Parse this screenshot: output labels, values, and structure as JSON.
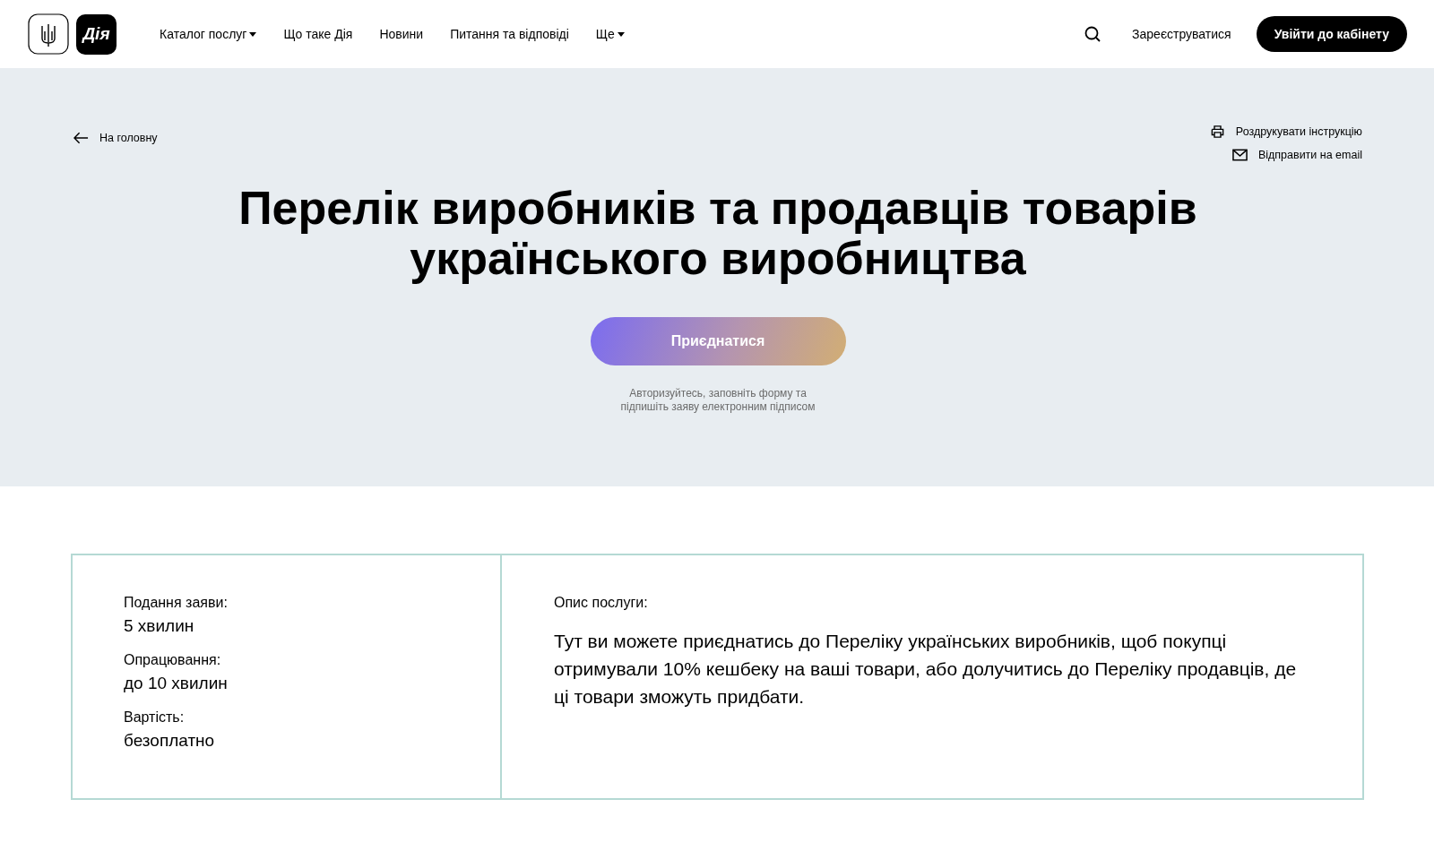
{
  "header": {
    "logo_text": "Дія",
    "nav": [
      {
        "label": "Каталог послуг",
        "dropdown": true
      },
      {
        "label": "Що таке Дія",
        "dropdown": false
      },
      {
        "label": "Новини",
        "dropdown": false
      },
      {
        "label": "Питання та відповіді",
        "dropdown": false
      },
      {
        "label": "Ще",
        "dropdown": true
      }
    ],
    "register": "Зареєструватися",
    "login": "Увійти до кабінету"
  },
  "hero": {
    "back": "На головну",
    "actions": [
      {
        "kind": "print",
        "label": "Роздрукувати інструкцію"
      },
      {
        "kind": "email",
        "label": "Відправити на email"
      }
    ],
    "title": "Перелік виробників та продавців товарів українського виробництва",
    "join": "Приєднатися",
    "hint": "Авторизуйтесь, заповніть форму та підпишіть заяву електронним підписом"
  },
  "info": {
    "facts": [
      {
        "label": "Подання заяви:",
        "value": "5 хвилин"
      },
      {
        "label": "Опрацювання:",
        "value": "до 10 хвилин"
      },
      {
        "label": "Вартість:",
        "value": "безоплатно"
      }
    ],
    "description_label": "Опис послуги:",
    "description": "Тут ви можете приєднатись до Переліку українських виробників, щоб покупці отримували 10% кешбеку на ваші товари, або долучитись до Переліку продавців, де ці товари зможуть придбати."
  }
}
